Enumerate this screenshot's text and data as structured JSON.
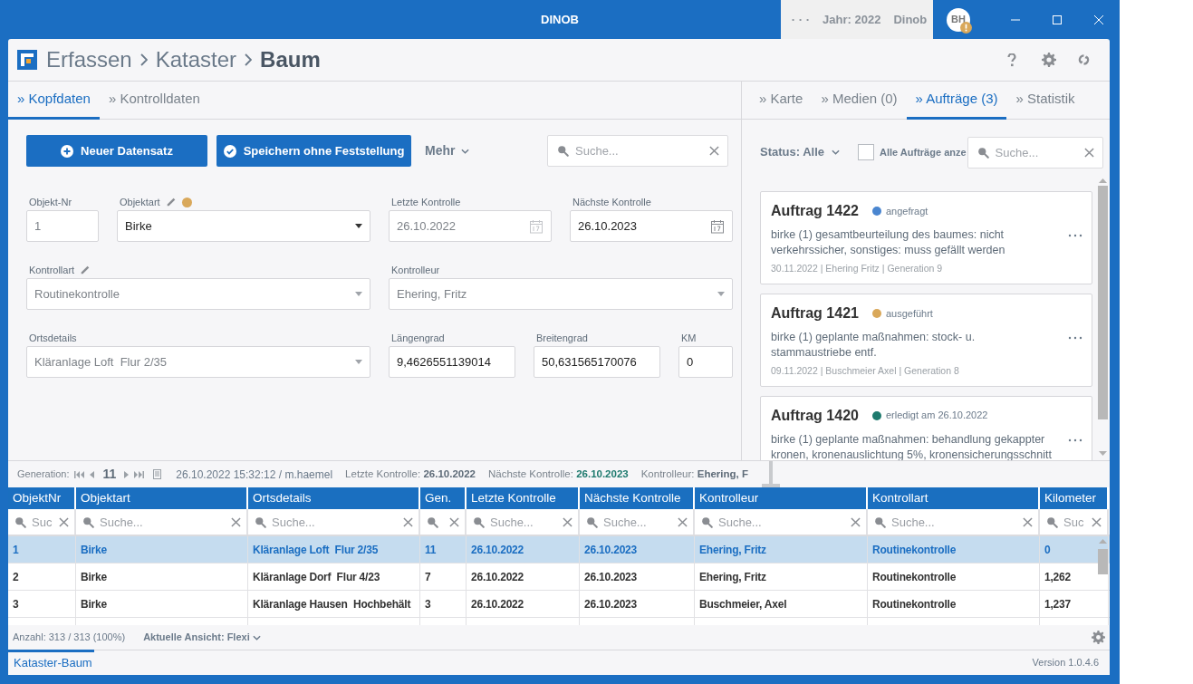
{
  "window": {
    "title": "DINOB",
    "status_items": [
      "· · ·",
      "Jahr: 2022",
      "Dinob"
    ],
    "avatar": "BH"
  },
  "header": {
    "breadcrumb": [
      "Erfassen",
      "Kataster"
    ],
    "current": "Baum"
  },
  "left_tabs": [
    {
      "label": "» Kopfdaten",
      "selected": true
    },
    {
      "label": "» Kontrolldaten",
      "selected": false
    }
  ],
  "toolbar": {
    "buttons": [
      {
        "label": "Neuer Datensatz",
        "kind": "add"
      },
      {
        "label": "Speichern ohne Feststellung",
        "kind": "save"
      }
    ],
    "menu": "Mehr",
    "search": {
      "placeholder": "Suche..."
    }
  },
  "form": {
    "fields": [
      {
        "label": "Objekt-Nr",
        "value": "1",
        "kind": "input",
        "disabled": true,
        "editable": false
      },
      {
        "label": "Objektart",
        "value": "Birke",
        "kind": "select",
        "disabled": false,
        "editable": true,
        "color": "#d9a85a"
      },
      {
        "label": "Letzte Kontrolle",
        "value": "26.10.2022",
        "kind": "date",
        "disabled": true,
        "editable": false
      },
      {
        "label": "Nächste Kontrolle",
        "value": "26.10.2023",
        "kind": "date",
        "disabled": false,
        "editable": false
      },
      {
        "label": "Kontrollart",
        "value": "Routinekontrolle",
        "kind": "select",
        "disabled": true,
        "editable": true
      },
      {
        "label": "Kontrolleur",
        "value": "Ehering, Fritz",
        "kind": "select",
        "disabled": true,
        "editable": false
      },
      {
        "label": "Ortsdetails",
        "value": "Kläranlage Loft  Flur 2/35",
        "kind": "select",
        "disabled": true,
        "editable": false
      },
      {
        "label": "Längengrad",
        "value": "9,4626551139014",
        "kind": "input",
        "disabled": false,
        "editable": false
      },
      {
        "label": "Breitengrad",
        "value": "50,631565170076",
        "kind": "input",
        "disabled": false,
        "editable": false
      },
      {
        "label": "KM",
        "value": "0",
        "kind": "input",
        "disabled": false,
        "editable": false
      }
    ]
  },
  "right_tabs": [
    {
      "label": "» Karte",
      "selected": false
    },
    {
      "label": "» Medien (0)",
      "selected": false
    },
    {
      "label": "» Aufträge (3)",
      "selected": true
    },
    {
      "label": "» Statistik",
      "selected": false
    }
  ],
  "orders_filter": {
    "status": "Status: Alle",
    "checkbox": {
      "label": "Alle Aufträge anze",
      "checked": false
    },
    "search": {
      "placeholder": "Suche..."
    }
  },
  "orders": [
    {
      "title": "Auftrag 1422",
      "status": "angefragt",
      "color": "#4a86d0",
      "description": "birke (1) gesamtbeurteilung des baumes: nicht verkehrssicher, sonstiges: muss gefällt werden",
      "meta": "30.11.2022 | Ehering Fritz | Generation 9"
    },
    {
      "title": "Auftrag 1421",
      "status": "ausgeführt",
      "color": "#d9a85a",
      "description": "birke (1) geplante maßnahmen: stock- u. stammaustriebe entf.",
      "meta": "09.11.2022 | Buschmeier Axel | Generation 8"
    },
    {
      "title": "Auftrag 1420",
      "status": "erledigt am 26.10.2022",
      "color": "#1e7a6e",
      "description": "birke (1) geplante maßnahmen: behandlung gekappter kronen, kronenauslichtung 5%, kronensicherungsschnitt"
    }
  ],
  "generation_bar": {
    "label": "Generation:",
    "number": "11",
    "timestamp": "26.10.2022 15:32:12 / m.haemel",
    "items": [
      {
        "label": "Letzte Kontrolle:",
        "value": "26.10.2022",
        "highlight": false
      },
      {
        "label": "Nächste Kontrolle:",
        "value": "26.10.2023",
        "highlight": true
      },
      {
        "label": "Kontrolleur:",
        "value": "Ehering, F",
        "highlight": false
      }
    ]
  },
  "table": {
    "columns": [
      {
        "label": "ObjektNr",
        "placeholder": "Suc"
      },
      {
        "label": "Objektart",
        "placeholder": "Suche..."
      },
      {
        "label": "Ortsdetails",
        "placeholder": "Suche..."
      },
      {
        "label": "Gen."
      },
      {
        "label": "Letzte Kontrolle",
        "placeholder": "Suche..."
      },
      {
        "label": "Nächste Kontrolle",
        "placeholder": "Suche..."
      },
      {
        "label": "Kontrolleur",
        "placeholder": "Suche..."
      },
      {
        "label": "Kontrollart",
        "placeholder": "Suche..."
      },
      {
        "label": "Kilometer",
        "placeholder": "Suc"
      }
    ],
    "rows": [
      {
        "selected": true,
        "cells": [
          "1",
          "Birke",
          "Kläranlage Loft  Flur 2/35",
          "11",
          "26.10.2022",
          "26.10.2023",
          "Ehering, Fritz",
          "Routinekontrolle",
          "0"
        ]
      },
      {
        "selected": false,
        "cells": [
          "2",
          "Birke",
          "Kläranlage Dorf  Flur 4/23",
          "7",
          "26.10.2022",
          "26.10.2023",
          "Ehering, Fritz",
          "Routinekontrolle",
          "1,262"
        ]
      },
      {
        "selected": false,
        "cells": [
          "3",
          "Birke",
          "Kläranlage Hausen  Hochbehält",
          "3",
          "26.10.2022",
          "26.10.2023",
          "Buschmeier, Axel",
          "Routinekontrolle",
          "1,237"
        ]
      }
    ]
  },
  "footer": {
    "count": "Anzahl: 313 / 313 (100%)",
    "view": "Aktuelle Ansicht: Flexi"
  },
  "bottom_tabs": [
    {
      "label": "Kataster-Baum",
      "selected": true
    }
  ],
  "version": "Version 1.0.4.6"
}
